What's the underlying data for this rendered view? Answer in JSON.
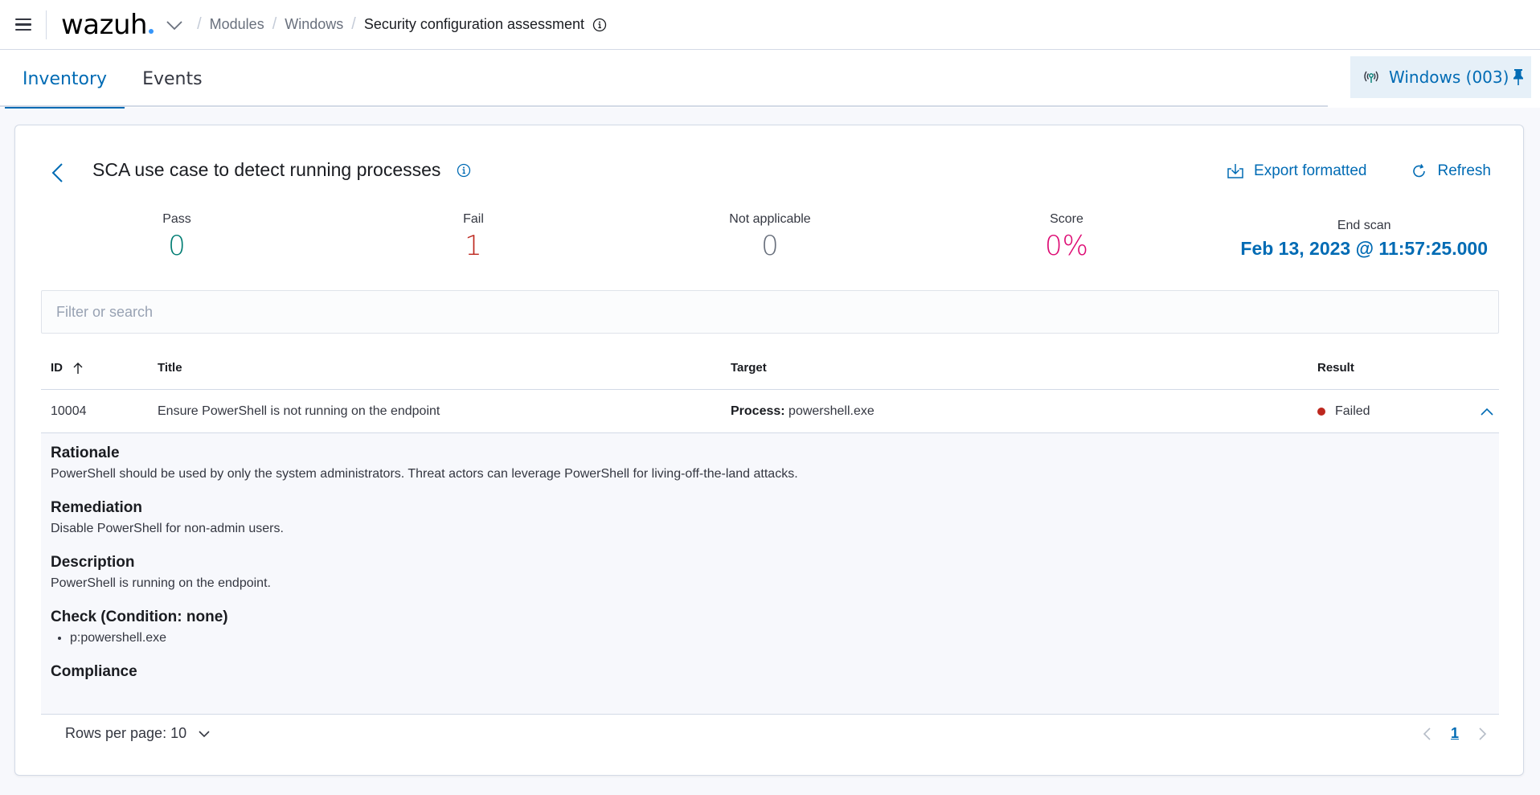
{
  "header": {
    "logo": "wazuh",
    "breadcrumb": [
      "Modules",
      "Windows",
      "Security configuration assessment"
    ]
  },
  "tabs": [
    {
      "label": "Inventory",
      "active": true
    },
    {
      "label": "Events",
      "active": false
    }
  ],
  "agent_pill": {
    "label": "Windows (003)"
  },
  "card": {
    "title": "SCA use case to detect running processes",
    "actions": {
      "export": "Export formatted",
      "refresh": "Refresh"
    },
    "stats": [
      {
        "label": "Pass",
        "value": "0",
        "color": "#017d73"
      },
      {
        "label": "Fail",
        "value": "1",
        "color": "#bd271e"
      },
      {
        "label": "Not applicable",
        "value": "0",
        "color": "#69707d"
      },
      {
        "label": "Score",
        "value": "0%",
        "color": "#dd0a73"
      }
    ],
    "end_scan": {
      "label": "End scan",
      "value": "Feb 13, 2023 @ 11:57:25.000"
    }
  },
  "search": {
    "placeholder": "Filter or search",
    "value": ""
  },
  "table": {
    "columns": [
      "ID",
      "Title",
      "Target",
      "Result"
    ],
    "rows": [
      {
        "id": "10004",
        "title": "Ensure PowerShell is not running on the endpoint",
        "target_label": "Process:",
        "target_value": "powershell.exe",
        "result": "Failed",
        "expanded": true
      }
    ],
    "details": {
      "rationale_heading": "Rationale",
      "rationale": "PowerShell should be used by only the system administrators. Threat actors can leverage PowerShell for living-off-the-land attacks.",
      "remediation_heading": "Remediation",
      "remediation": "Disable PowerShell for non-admin users.",
      "description_heading": "Description",
      "description": "PowerShell is running on the endpoint.",
      "check_heading": "Check (Condition: none)",
      "checks": [
        "p:powershell.exe"
      ],
      "compliance_heading": "Compliance"
    }
  },
  "footer": {
    "rows_per_page": "Rows per page: 10",
    "current_page": "1"
  }
}
